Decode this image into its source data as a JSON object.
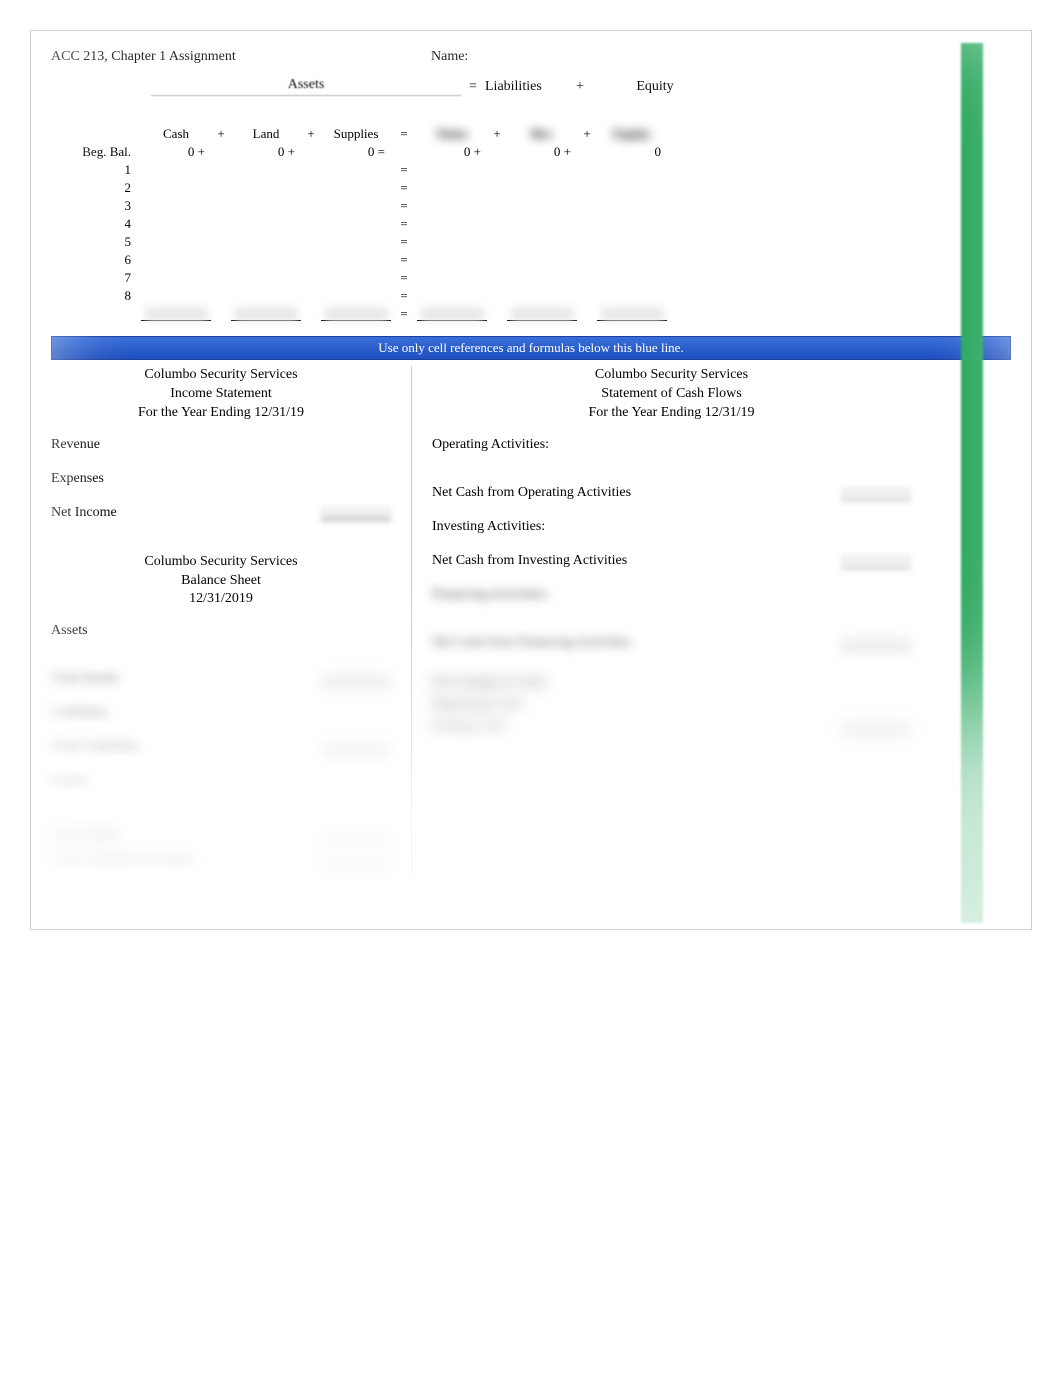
{
  "header": {
    "title": "ACC 213, Chapter 1 Assignment",
    "name_label": "Name:"
  },
  "equation": {
    "assets": "Assets",
    "eq": "=",
    "liabilities": "Liabilities",
    "plus": "+",
    "equity": "Equity"
  },
  "cols": {
    "cash": "Cash",
    "land": "Land",
    "supplies": "Supplies",
    "liab_blur": "Notes",
    "eq1_blur": "Rev",
    "eq2_blur": "Equity"
  },
  "beg": {
    "label": "Beg. Bal.",
    "zero": "0",
    "zero_plus": "0 +",
    "zero_eq": "0 =",
    "last_zero": "0"
  },
  "rows": [
    "1",
    "2",
    "3",
    "4",
    "5",
    "6",
    "7",
    "8"
  ],
  "eq_sign": "=",
  "plus_sign": "+",
  "blue_bar": "Use only cell references and formulas below this blue line.",
  "income_stmt": {
    "company": "Columbo Security Services",
    "title": "Income Statement",
    "period": "For the Year Ending 12/31/19",
    "revenue": "Revenue",
    "expenses": "Expenses",
    "net_income": "Net Income"
  },
  "bal_sheet": {
    "company": "Columbo Security Services",
    "title": "Balance Sheet",
    "date": "12/31/2019",
    "assets": "Assets",
    "total_assets": "Total Assets",
    "liabilities": "Liabilities",
    "total_liabilities": "Total Liabilities",
    "equity": "Equity",
    "total_equity": "Total Equity",
    "total_liab_equity": "Total Liabilities & Equity"
  },
  "cash_flow": {
    "company": "Columbo Security Services",
    "title": "Statement of Cash Flows",
    "period": "For the Year Ending 12/31/19",
    "operating": "Operating Activities:",
    "net_op": "Net Cash from Operating Activities",
    "investing": "Investing Activities:",
    "net_inv": "Net Cash from Investing Activities",
    "financing": "Financing Activities:",
    "net_fin": "Net Cash from Financing Activities",
    "net_change": "Net Change in Cash",
    "beg_cash": "Beginning Cash",
    "end_cash": "Ending Cash"
  }
}
